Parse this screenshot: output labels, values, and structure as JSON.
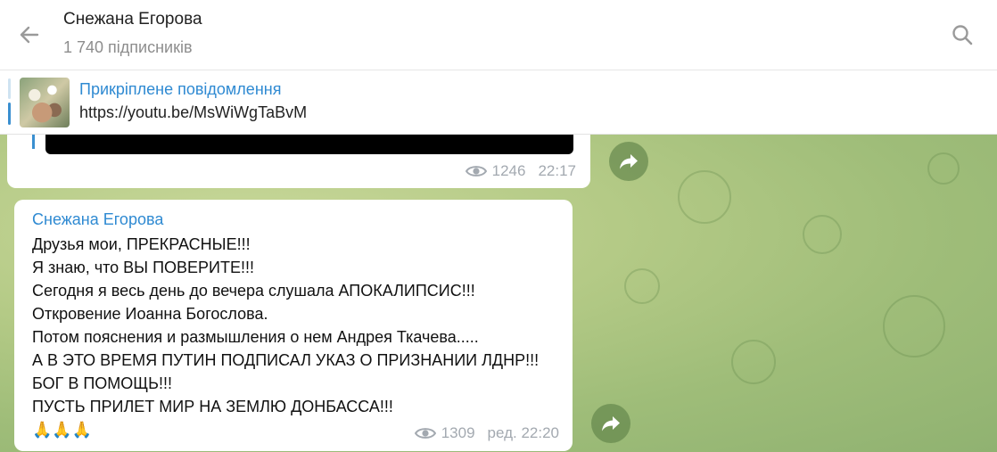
{
  "header": {
    "channel_name": "Снежана Егорова",
    "subscribers": "1 740 підписників"
  },
  "pinned": {
    "label": "Прикріплене повідомлення",
    "text": "https://youtu.be/MsWiWgTaBvM"
  },
  "messages": [
    {
      "views": "1246",
      "time": "22:17"
    },
    {
      "sender": "Снежана Егорова",
      "lines": [
        "Друзья мои, ПРЕКРАСНЫЕ!!!",
        "Я знаю, что ВЫ ПОВЕРИТЕ!!!",
        "Сегодня я весь день до вечера слушала АПОКАЛИПСИС!!!",
        "Откровение Иоанна Богослова.",
        "Потом пояснения и размышления о нем Андрея Ткачева.....",
        "А В ЭТО ВРЕМЯ ПУТИН ПОДПИСАЛ УКАЗ О ПРИЗНАНИИ ЛДНР!!!",
        "БОГ В ПОМОЩЬ!!!",
        "ПУСТЬ ПРИЛЕТ МИР НА ЗЕМЛЮ ДОНБАССА!!!",
        "🙏🙏🙏"
      ],
      "views": "1309",
      "time": "ред. 22:20"
    }
  ],
  "icons": {
    "back": "arrow-left-icon",
    "search": "search-icon",
    "views": "eye-icon",
    "share": "share-arrow-icon"
  },
  "colors": {
    "accent": "#2f8ad2",
    "chat_background": "#b4ca86",
    "meta_text": "#a3a9b0"
  }
}
